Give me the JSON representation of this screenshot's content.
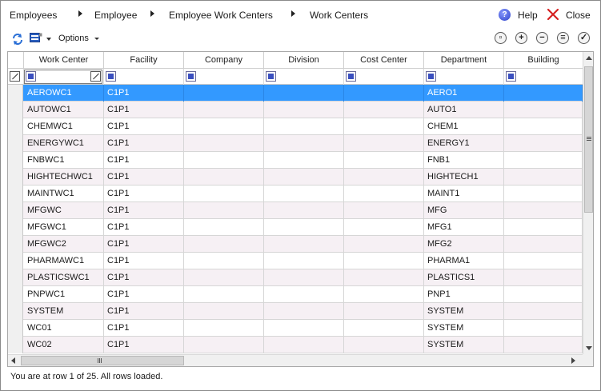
{
  "breadcrumb": {
    "items": [
      "Employees",
      "Employee",
      "Employee Work Centers",
      "Work Centers"
    ]
  },
  "header_actions": {
    "help_label": "Help",
    "close_label": "Close"
  },
  "toolbar": {
    "options_label": "Options"
  },
  "grid": {
    "columns": [
      "Work Center",
      "Facility",
      "Company",
      "Division",
      "Cost Center",
      "Department",
      "Building"
    ],
    "rows": [
      [
        "AEROWC1",
        "C1P1",
        "",
        "",
        "",
        "AERO1",
        ""
      ],
      [
        "AUTOWC1",
        "C1P1",
        "",
        "",
        "",
        "AUTO1",
        ""
      ],
      [
        "CHEMWC1",
        "C1P1",
        "",
        "",
        "",
        "CHEM1",
        ""
      ],
      [
        "ENERGYWC1",
        "C1P1",
        "",
        "",
        "",
        "ENERGY1",
        ""
      ],
      [
        "FNBWC1",
        "C1P1",
        "",
        "",
        "",
        "FNB1",
        ""
      ],
      [
        "HIGHTECHWC1",
        "C1P1",
        "",
        "",
        "",
        "HIGHTECH1",
        ""
      ],
      [
        "MAINTWC1",
        "C1P1",
        "",
        "",
        "",
        "MAINT1",
        ""
      ],
      [
        "MFGWC",
        "C1P1",
        "",
        "",
        "",
        "MFG",
        ""
      ],
      [
        "MFGWC1",
        "C1P1",
        "",
        "",
        "",
        "MFG1",
        ""
      ],
      [
        "MFGWC2",
        "C1P1",
        "",
        "",
        "",
        "MFG2",
        ""
      ],
      [
        "PHARMAWC1",
        "C1P1",
        "",
        "",
        "",
        "PHARMA1",
        ""
      ],
      [
        "PLASTICSWC1",
        "C1P1",
        "",
        "",
        "",
        "PLASTICS1",
        ""
      ],
      [
        "PNPWC1",
        "C1P1",
        "",
        "",
        "",
        "PNP1",
        ""
      ],
      [
        "SYSTEM",
        "C1P1",
        "",
        "",
        "",
        "SYSTEM",
        ""
      ],
      [
        "WC01",
        "C1P1",
        "",
        "",
        "",
        "SYSTEM",
        ""
      ],
      [
        "WC02",
        "C1P1",
        "",
        "",
        "",
        "SYSTEM",
        ""
      ]
    ],
    "selected_row": 0
  },
  "status": {
    "text": "You are at row 1 of 25. All rows loaded."
  },
  "colors": {
    "selection": "#3399ff",
    "alt_row": "#f6f0f4",
    "close_red": "#d62020"
  }
}
